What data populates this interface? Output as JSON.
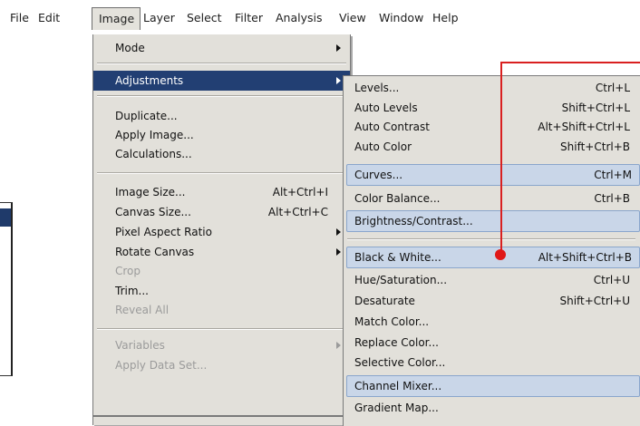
{
  "menubar": {
    "items": [
      "File",
      "Edit",
      "Image",
      "Layer",
      "Select",
      "Filter",
      "Analysis",
      "View",
      "Window",
      "Help"
    ]
  },
  "image_menu": {
    "mode": "Mode",
    "adjustments": "Adjustments",
    "duplicate": "Duplicate...",
    "apply_image": "Apply Image...",
    "calculations": "Calculations...",
    "image_size": "Image Size...",
    "image_size_sc": "Alt+Ctrl+I",
    "canvas_size": "Canvas Size...",
    "canvas_size_sc": "Alt+Ctrl+C",
    "pixel_aspect": "Pixel Aspect Ratio",
    "rotate_canvas": "Rotate Canvas",
    "crop": "Crop",
    "trim": "Trim...",
    "reveal_all": "Reveal All",
    "variables": "Variables",
    "apply_data_set": "Apply Data Set..."
  },
  "adjustments_menu": {
    "levels": "Levels...",
    "levels_sc": "Ctrl+L",
    "auto_levels": "Auto Levels",
    "auto_levels_sc": "Shift+Ctrl+L",
    "auto_contrast": "Auto Contrast",
    "auto_contrast_sc": "Alt+Shift+Ctrl+L",
    "auto_color": "Auto Color",
    "auto_color_sc": "Shift+Ctrl+B",
    "curves": "Curves...",
    "curves_sc": "Ctrl+M",
    "color_balance": "Color Balance...",
    "color_balance_sc": "Ctrl+B",
    "brightness_contrast": "Brightness/Contrast...",
    "black_white": "Black & White...",
    "black_white_sc": "Alt+Shift+Ctrl+B",
    "hue_saturation": "Hue/Saturation...",
    "hue_saturation_sc": "Ctrl+U",
    "desaturate": "Desaturate",
    "desaturate_sc": "Shift+Ctrl+U",
    "match_color": "Match Color...",
    "replace_color": "Replace Color...",
    "selective_color": "Selective Color...",
    "channel_mixer": "Channel Mixer...",
    "gradient_map": "Gradient Map..."
  },
  "colors": {
    "highlight": "#223f73",
    "menu_bg": "#e2e0da",
    "hover_box": "#c9d6e8",
    "callout_red": "#d92020"
  }
}
